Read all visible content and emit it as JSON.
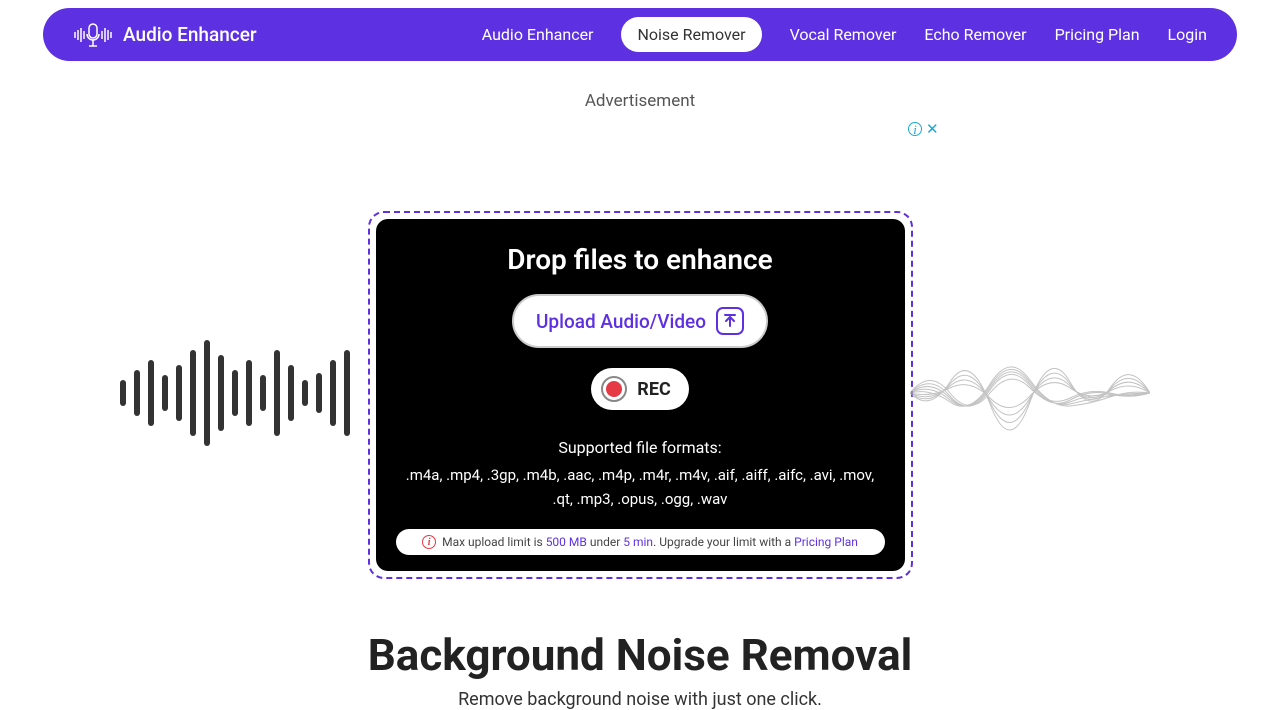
{
  "brand": "Audio Enhancer",
  "nav": {
    "items": [
      "Audio Enhancer",
      "Noise Remover",
      "Vocal Remover",
      "Echo Remover",
      "Pricing Plan",
      "Login"
    ]
  },
  "ad": {
    "label": "Advertisement"
  },
  "upload": {
    "title": "Drop files to enhance",
    "button_label": "Upload Audio/Video",
    "rec_label": "REC",
    "formats_label": "Supported file formats:",
    "formats_list": ".m4a, .mp4, .3gp, .m4b, .aac, .m4p, .m4r, .m4v, .aif, .aiff, .aifc, .avi, .mov, .qt, .mp3, .opus, .ogg, .wav",
    "limit": {
      "prefix": "Max upload limit is ",
      "size": "500 MB",
      "mid": " under ",
      "duration": "5 min",
      "suffix": ". Upgrade your limit with a ",
      "link": "Pricing Plan"
    }
  },
  "section": {
    "title": "Background Noise Removal",
    "sub": "Remove background noise with just one click."
  }
}
